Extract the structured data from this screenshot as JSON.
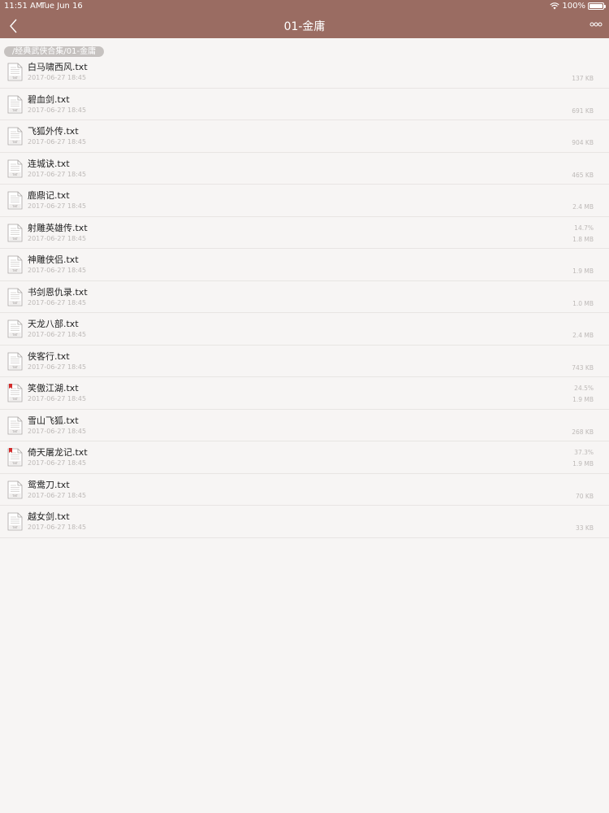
{
  "status": {
    "time": "11:51 AM",
    "date": "Tue Jun 16",
    "battery": "100%"
  },
  "nav": {
    "title": "01-金庸"
  },
  "path": "/经典武侠合集/01-金庸",
  "colors": {
    "bar": "#9a6c62",
    "background": "#f7f5f4",
    "bookmark": "#d42a2a"
  },
  "files": [
    {
      "name": "白马啸西风.txt",
      "date": "2017-06-27 18:45",
      "progress": "",
      "size": "137 KB",
      "bookmarked": false
    },
    {
      "name": "碧血剑.txt",
      "date": "2017-06-27 18:45",
      "progress": "",
      "size": "691 KB",
      "bookmarked": false
    },
    {
      "name": "飞狐外传.txt",
      "date": "2017-06-27 18:45",
      "progress": "",
      "size": "904 KB",
      "bookmarked": false
    },
    {
      "name": "连城诀.txt",
      "date": "2017-06-27 18:45",
      "progress": "",
      "size": "465 KB",
      "bookmarked": false
    },
    {
      "name": "鹿鼎记.txt",
      "date": "2017-06-27 18:45",
      "progress": "",
      "size": "2.4 MB",
      "bookmarked": false
    },
    {
      "name": "射雕英雄传.txt",
      "date": "2017-06-27 18:45",
      "progress": "14.7%",
      "size": "1.8 MB",
      "bookmarked": false
    },
    {
      "name": "神雕侠侣.txt",
      "date": "2017-06-27 18:45",
      "progress": "",
      "size": "1.9 MB",
      "bookmarked": false
    },
    {
      "name": "书剑恩仇录.txt",
      "date": "2017-06-27 18:45",
      "progress": "",
      "size": "1.0 MB",
      "bookmarked": false
    },
    {
      "name": "天龙八部.txt",
      "date": "2017-06-27 18:45",
      "progress": "",
      "size": "2.4 MB",
      "bookmarked": false
    },
    {
      "name": "侠客行.txt",
      "date": "2017-06-27 18:45",
      "progress": "",
      "size": "743 KB",
      "bookmarked": false
    },
    {
      "name": "笑傲江湖.txt",
      "date": "2017-06-27 18:45",
      "progress": "24.5%",
      "size": "1.9 MB",
      "bookmarked": true
    },
    {
      "name": "雪山飞狐.txt",
      "date": "2017-06-27 18:45",
      "progress": "",
      "size": "268 KB",
      "bookmarked": false
    },
    {
      "name": "倚天屠龙记.txt",
      "date": "2017-06-27 18:45",
      "progress": "37.3%",
      "size": "1.9 MB",
      "bookmarked": true
    },
    {
      "name": "鸳鸯刀.txt",
      "date": "2017-06-27 18:45",
      "progress": "",
      "size": "70 KB",
      "bookmarked": false
    },
    {
      "name": "越女剑.txt",
      "date": "2017-06-27 18:45",
      "progress": "",
      "size": "33 KB",
      "bookmarked": false
    }
  ]
}
